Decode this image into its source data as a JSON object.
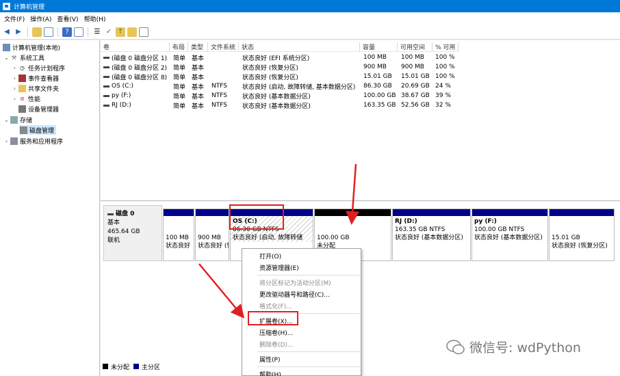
{
  "window": {
    "title": "计算机管理"
  },
  "menu": [
    "文件(F)",
    "操作(A)",
    "查看(V)",
    "帮助(H)"
  ],
  "tree": {
    "root": "计算机管理(本地)",
    "system_tools": "系统工具",
    "task_scheduler": "任务计划程序",
    "event_viewer": "事件查看器",
    "shared_folders": "共享文件夹",
    "performance": "性能",
    "device_manager": "设备管理器",
    "storage": "存储",
    "disk_management": "磁盘管理",
    "services": "服务和应用程序"
  },
  "volumes": {
    "columns": [
      "卷",
      "布局",
      "类型",
      "文件系统",
      "状态",
      "容量",
      "可用空间",
      "% 可用"
    ],
    "rows": [
      [
        "(磁盘 0 磁盘分区 1)",
        "简单",
        "基本",
        "",
        "状态良好 (EFI 系统分区)",
        "100 MB",
        "100 MB",
        "100 %"
      ],
      [
        "(磁盘 0 磁盘分区 2)",
        "简单",
        "基本",
        "",
        "状态良好 (恢复分区)",
        "900 MB",
        "900 MB",
        "100 %"
      ],
      [
        "(磁盘 0 磁盘分区 8)",
        "简单",
        "基本",
        "",
        "状态良好 (恢复分区)",
        "15.01 GB",
        "15.01 GB",
        "100 %"
      ],
      [
        "OS (C:)",
        "简单",
        "基本",
        "NTFS",
        "状态良好 (启动, 故障转储, 基本数据分区)",
        "86.30 GB",
        "20.69 GB",
        "24 %"
      ],
      [
        "py (F:)",
        "简单",
        "基本",
        "NTFS",
        "状态良好 (基本数据分区)",
        "100.00 GB",
        "38.67 GB",
        "39 %"
      ],
      [
        "RJ (D:)",
        "简单",
        "基本",
        "NTFS",
        "状态良好 (基本数据分区)",
        "163.35 GB",
        "52.56 GB",
        "32 %"
      ]
    ]
  },
  "disk0": {
    "name": "磁盘 0",
    "type": "基本",
    "size": "465.64 GB",
    "status": "联机"
  },
  "partitions": [
    {
      "l1": "",
      "l2": "100 MB",
      "l3": "状态良好"
    },
    {
      "l1": "",
      "l2": "900 MB",
      "l3": "状态良好 (恢"
    },
    {
      "l1": "OS  (C:)",
      "l2": "86.30 GB NTFS",
      "l3": "状态良好 (启动, 故障转储"
    },
    {
      "l1": "",
      "l2": "100.00 GB",
      "l3": "未分配"
    },
    {
      "l1": "RJ  (D:)",
      "l2": "163.35 GB NTFS",
      "l3": "状态良好 (基本数据分区)"
    },
    {
      "l1": "py  (F:)",
      "l2": "100.00 GB NTFS",
      "l3": "状态良好 (基本数据分区)"
    },
    {
      "l1": "",
      "l2": "15.01 GB",
      "l3": "状态良好 (恢复分区)"
    }
  ],
  "legend": {
    "unallocated": "未分配",
    "primary": "主分区"
  },
  "context_menu": {
    "open": "打开(O)",
    "explore": "资源管理器(E)",
    "mark_active": "将分区标记为活动分区(M)",
    "change_letter": "更改驱动器号和路径(C)...",
    "format": "格式化(F)...",
    "extend": "扩展卷(X)...",
    "shrink": "压缩卷(H)...",
    "delete": "删除卷(D)...",
    "properties": "属性(P)",
    "help": "帮助(H)"
  },
  "watermark": "微信号: wdPython",
  "colors": {
    "primary_partition": "#00008b",
    "unallocated": "#000000",
    "highlight": "#e02020",
    "titlebar": "#0078d7"
  }
}
